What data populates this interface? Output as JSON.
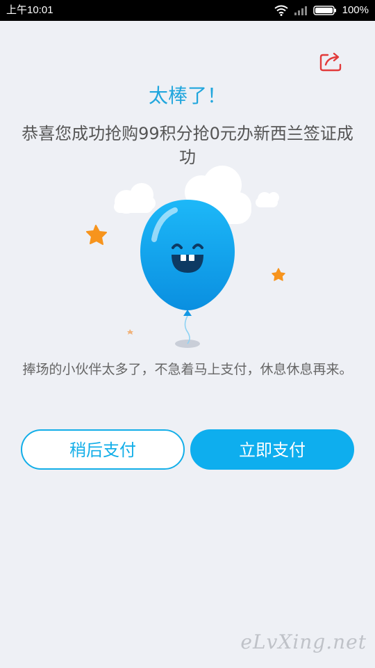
{
  "status_bar": {
    "time": "上午10:01",
    "battery_percent": "100%",
    "icons": [
      "wifi-icon",
      "signal-icon",
      "battery-icon"
    ]
  },
  "share": {
    "icon": "share-icon"
  },
  "result": {
    "title": "太棒了！",
    "message": "恭喜您成功抢购99积分抢0元办新西兰签证成功",
    "hint": "捧场的小伙伴太多了，不急着马上支付，休息休息再来。"
  },
  "buttons": {
    "later_label": "稍后支付",
    "now_label": "立即支付"
  },
  "colors": {
    "accent": "#0eaeee",
    "title": "#20a6dd",
    "star": "#f7941d",
    "background": "#eef0f5"
  },
  "watermark": "eLvXing.net"
}
